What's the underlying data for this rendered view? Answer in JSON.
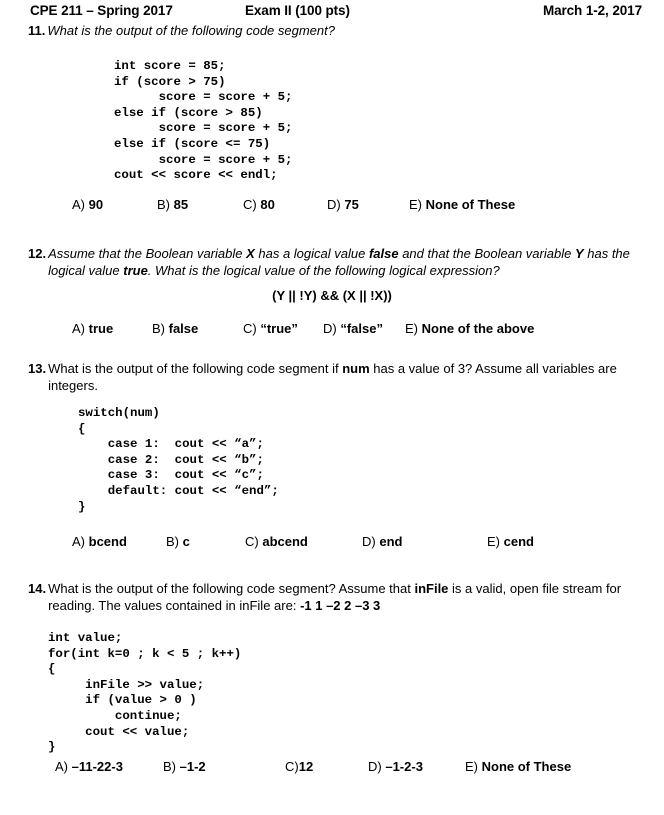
{
  "header": {
    "course": "CPE 211 – Spring 2017",
    "exam": "Exam II (100 pts)",
    "date": "March 1-2, 2017"
  },
  "questions": [
    {
      "number": "11.",
      "prompt": "What is the output of the following code segment?",
      "code": "int score = 85;\nif (score > 75)\n      score = score + 5;\nelse if (score > 85)\n      score = score + 5;\nelse if (score <= 75)\n      score = score + 5;\ncout << score << endl;",
      "options": [
        {
          "label": "A)",
          "value": "90"
        },
        {
          "label": "B)",
          "value": "85"
        },
        {
          "label": "C)",
          "value": "80"
        },
        {
          "label": "D)",
          "value": "75"
        },
        {
          "label": "E)",
          "value": "None of These"
        }
      ]
    },
    {
      "number": "12.",
      "prompt_line1_a": "Assume that the Boolean variable ",
      "prompt_line1_b": "X",
      "prompt_line1_c": " has a logical value ",
      "prompt_line1_d": "false",
      "prompt_line1_e": " and that the Boolean variable",
      "prompt_line2_a": "Y",
      "prompt_line2_b": " has the logical value ",
      "prompt_line2_c": "true",
      "prompt_line2_d": ".  What is the logical value of the following logical expression?",
      "expression": "(Y || !Y) && (X || !X))",
      "options": [
        {
          "label": "A)",
          "value": "true"
        },
        {
          "label": "B)",
          "value": "false"
        },
        {
          "label": "C)",
          "value": "“true”"
        },
        {
          "label": "D)",
          "value": "“false”"
        },
        {
          "label": "E)",
          "value": "None of the above"
        }
      ]
    },
    {
      "number": "13.",
      "prompt_a": "What is the output of the following code segment if ",
      "prompt_b": "num",
      "prompt_c": " has a value of 3?  Assume all variables are",
      "prompt_d": "integers.",
      "code": "switch(num)\n{\n    case 1:  cout << “a”;\n    case 2:  cout << “b”;\n    case 3:  cout << “c”;\n    default: cout << “end”;\n}",
      "options": [
        {
          "label": "A)",
          "value": "bcend"
        },
        {
          "label": "B)",
          "value": "c"
        },
        {
          "label": "C)",
          "value": "abcend"
        },
        {
          "label": "D)",
          "value": "end"
        },
        {
          "label": "E)",
          "value": "cend"
        }
      ]
    },
    {
      "number": "14.",
      "prompt_a": "What is the output of the following code segment?  Assume that ",
      "prompt_b": "inFile",
      "prompt_c": " is a valid, open file stream for",
      "prompt_d": "reading.  The values contained in inFile are:  ",
      "prompt_e": "-1  1  –2  2  –3  3",
      "code": "int value;\nfor(int k=0 ; k < 5 ; k++)\n{\n     inFile >> value;\n     if (value > 0 )\n         continue;\n     cout << value;\n}",
      "options": [
        {
          "label": "A)",
          "value": "–11-22-3"
        },
        {
          "label": "B)",
          "value": "–1-2"
        },
        {
          "label": "C)",
          "value": "12"
        },
        {
          "label": "D)",
          "value": "–1-2-3"
        },
        {
          "label": "E)",
          "value": "None of These"
        }
      ]
    }
  ]
}
